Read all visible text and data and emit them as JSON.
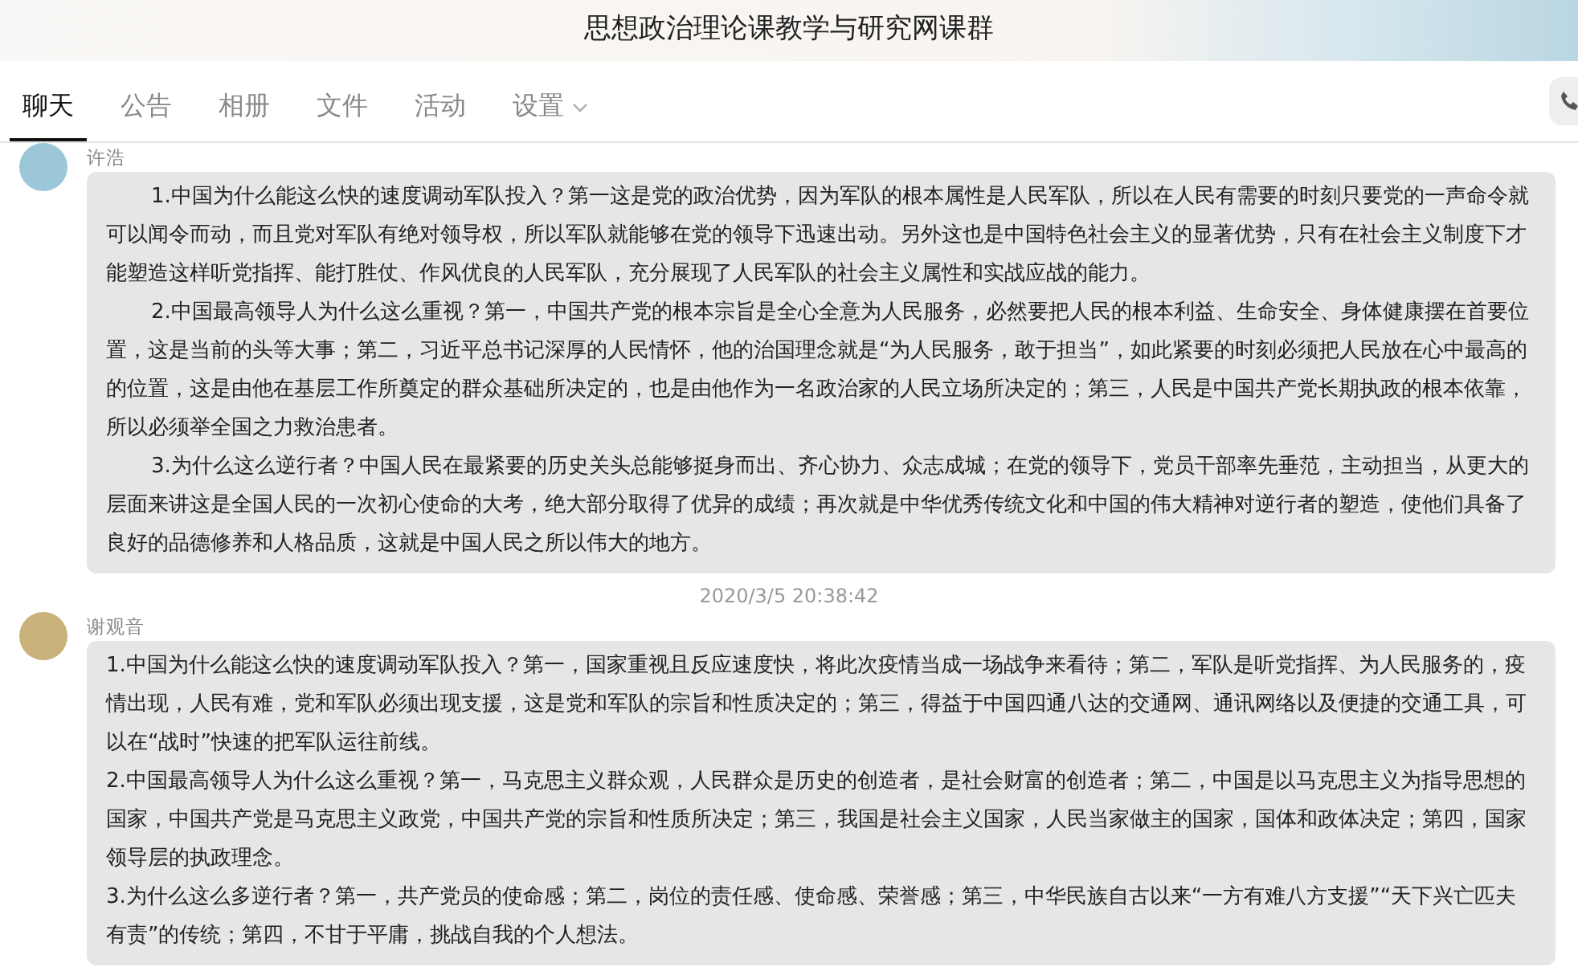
{
  "window": {
    "title": "思想政治理论课教学与研究网课群"
  },
  "tabs": [
    {
      "label": "聊天",
      "selected": true,
      "dropdown": false
    },
    {
      "label": "公告",
      "selected": false,
      "dropdown": false
    },
    {
      "label": "相册",
      "selected": false,
      "dropdown": false
    },
    {
      "label": "文件",
      "selected": false,
      "dropdown": false
    },
    {
      "label": "活动",
      "selected": false,
      "dropdown": false
    },
    {
      "label": "设置",
      "selected": false,
      "dropdown": true
    }
  ],
  "messages": [
    {
      "kind": "message",
      "sender": "许浩",
      "indented": true,
      "paragraphs": [
        "1.中国为什么能这么快的速度调动军队投入？第一这是党的政治优势，因为军队的根本属性是人民军队，所以在人民有需要的时刻只要党的一声命令就可以闻令而动，而且党对军队有绝对领导权，所以军队就能够在党的领导下迅速出动。另外这也是中国特色社会主义的显著优势，只有在社会主义制度下才能塑造这样听党指挥、能打胜仗、作风优良的人民军队，充分展现了人民军队的社会主义属性和实战应战的能力。",
        "2.中国最高领导人为什么这么重视？第一，中国共产党的根本宗旨是全心全意为人民服务，必然要把人民的根本利益、生命安全、身体健康摆在首要位置，这是当前的头等大事；第二，习近平总书记深厚的人民情怀，他的治国理念就是“为人民服务，敢于担当”，如此紧要的时刻必须把人民放在心中最高的的位置，这是由他在基层工作所奠定的群众基础所决定的，也是由他作为一名政治家的人民立场所决定的；第三，人民是中国共产党长期执政的根本依靠，所以必须举全国之力救治患者。",
        "3.为什么这么逆行者？中国人民在最紧要的历史关头总能够挺身而出、齐心协力、众志成城；在党的领导下，党员干部率先垂范，主动担当，从更大的层面来讲这是全国人民的一次初心使命的大考，绝大部分取得了优异的成绩；再次就是中华优秀传统文化和中国的伟大精神对逆行者的塑造，使他们具备了良好的品德修养和人格品质，这就是中国人民之所以伟大的地方。"
      ]
    },
    {
      "kind": "timestamp",
      "text": "2020/3/5 20:38:42"
    },
    {
      "kind": "message",
      "sender": "谢观音",
      "indented": false,
      "paragraphs": [
        "1.中国为什么能这么快的速度调动军队投入？第一，国家重视且反应速度快，将此次疫情当成一场战争来看待；第二，军队是听党指挥、为人民服务的，疫情出现，人民有难，党和军队必须出现支援，这是党和军队的宗旨和性质决定的；第三，得益于中国四通八达的交通网、通讯网络以及便捷的交通工具，可以在“战时”快速的把军队运往前线。",
        "2.中国最高领导人为什么这么重视？第一，马克思主义群众观，人民群众是历史的创造者，是社会财富的创造者；第二，中国是以马克思主义为指导思想的国家，中国共产党是马克思主义政党，中国共产党的宗旨和性质所决定；第三，我国是社会主义国家，人民当家做主的国家，国体和政体决定；第四，国家领导层的执政理念。",
        "3.为什么这么多逆行者？第一，共产党员的使命感；第二，岗位的责任感、使命感、荣誉感；第三，中华民族自古以来“一方有难八方支援”“天下兴亡匹夫有责”的传统；第四，不甘于平庸，挑战自我的个人想法。"
      ]
    }
  ]
}
